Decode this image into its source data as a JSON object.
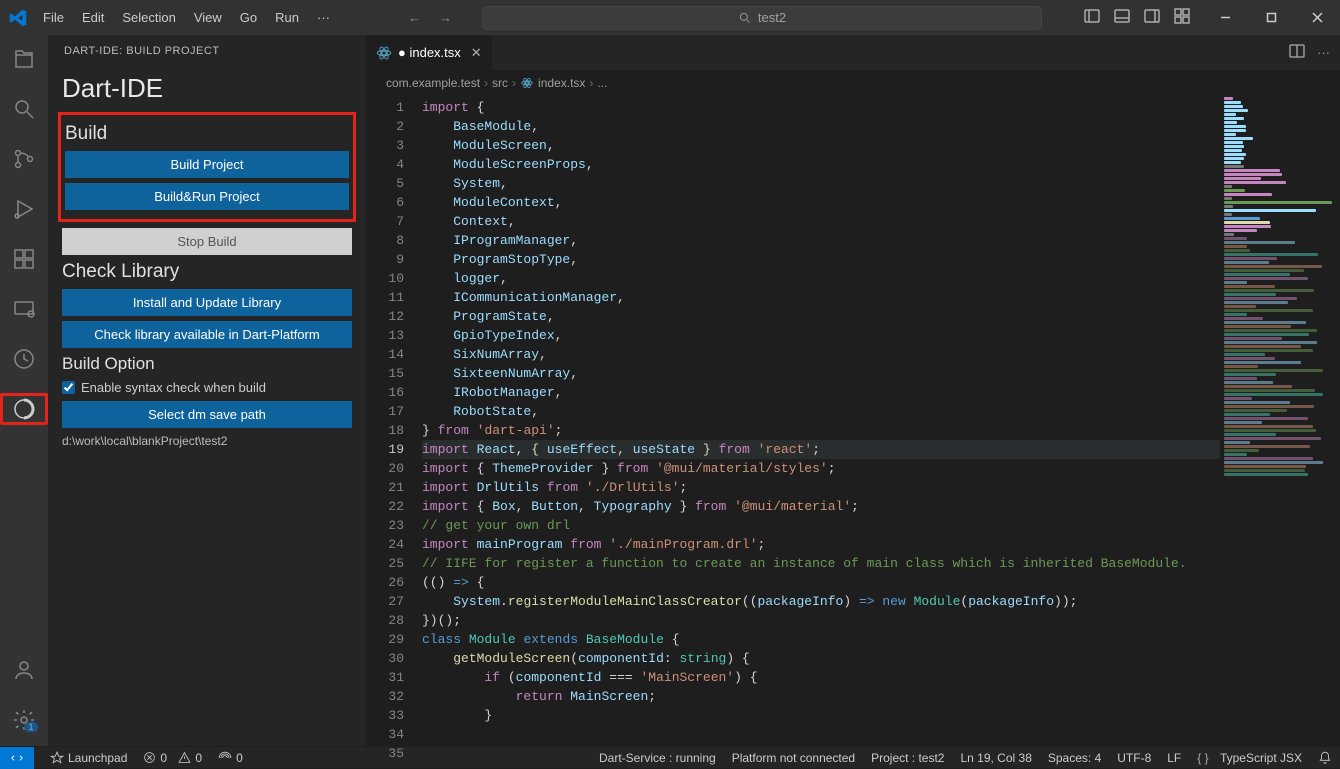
{
  "titlebar": {
    "menus": [
      "File",
      "Edit",
      "Selection",
      "View",
      "Go",
      "Run",
      "···"
    ],
    "search": "test2"
  },
  "sidebar": {
    "header": "DART-IDE: BUILD PROJECT",
    "title": "Dart-IDE",
    "build": {
      "heading": "Build",
      "build_project": "Build Project",
      "build_run": "Build&Run Project",
      "stop": "Stop Build"
    },
    "check": {
      "heading": "Check Library",
      "install": "Install and Update Library",
      "available": "Check library available in Dart-Platform"
    },
    "option": {
      "heading": "Build Option",
      "syntax_label": "Enable syntax check when build",
      "select_path": "Select dm save path",
      "path": "d:\\work\\local\\blankProject\\test2"
    }
  },
  "editor": {
    "tab": "index.tsx",
    "breadcrumb": [
      "com.example.test",
      "src",
      "index.tsx",
      "..."
    ],
    "lines": [
      {
        "n": 1,
        "seg": [
          [
            "k",
            "import"
          ],
          [
            "w",
            " {"
          ]
        ]
      },
      {
        "n": 2,
        "seg": [
          [
            "w",
            "    "
          ],
          [
            "v",
            "BaseModule"
          ],
          [
            "w",
            ","
          ]
        ]
      },
      {
        "n": 3,
        "seg": [
          [
            "w",
            "    "
          ],
          [
            "v",
            "ModuleScreen"
          ],
          [
            "w",
            ","
          ]
        ]
      },
      {
        "n": 4,
        "seg": [
          [
            "w",
            "    "
          ],
          [
            "v",
            "ModuleScreenProps"
          ],
          [
            "w",
            ","
          ]
        ]
      },
      {
        "n": 5,
        "seg": [
          [
            "w",
            "    "
          ],
          [
            "v",
            "System"
          ],
          [
            "w",
            ","
          ]
        ]
      },
      {
        "n": 6,
        "seg": [
          [
            "w",
            "    "
          ],
          [
            "v",
            "ModuleContext"
          ],
          [
            "w",
            ","
          ]
        ]
      },
      {
        "n": 7,
        "seg": [
          [
            "w",
            "    "
          ],
          [
            "v",
            "Context"
          ],
          [
            "w",
            ","
          ]
        ]
      },
      {
        "n": 8,
        "seg": [
          [
            "w",
            "    "
          ],
          [
            "v",
            "IProgramManager"
          ],
          [
            "w",
            ","
          ]
        ]
      },
      {
        "n": 9,
        "seg": [
          [
            "w",
            "    "
          ],
          [
            "v",
            "ProgramStopType"
          ],
          [
            "w",
            ","
          ]
        ]
      },
      {
        "n": 10,
        "seg": [
          [
            "w",
            "    "
          ],
          [
            "v",
            "logger"
          ],
          [
            "w",
            ","
          ]
        ]
      },
      {
        "n": 11,
        "seg": [
          [
            "w",
            "    "
          ],
          [
            "v",
            "ICommunicationManager"
          ],
          [
            "w",
            ","
          ]
        ]
      },
      {
        "n": 12,
        "seg": [
          [
            "w",
            "    "
          ],
          [
            "v",
            "ProgramState"
          ],
          [
            "w",
            ","
          ]
        ]
      },
      {
        "n": 13,
        "seg": [
          [
            "w",
            "    "
          ],
          [
            "v",
            "GpioTypeIndex"
          ],
          [
            "w",
            ","
          ]
        ]
      },
      {
        "n": 14,
        "seg": [
          [
            "w",
            "    "
          ],
          [
            "v",
            "SixNumArray"
          ],
          [
            "w",
            ","
          ]
        ]
      },
      {
        "n": 15,
        "seg": [
          [
            "w",
            "    "
          ],
          [
            "v",
            "SixteenNumArray"
          ],
          [
            "w",
            ","
          ]
        ]
      },
      {
        "n": 16,
        "seg": [
          [
            "w",
            "    "
          ],
          [
            "v",
            "IRobotManager"
          ],
          [
            "w",
            ","
          ]
        ]
      },
      {
        "n": 17,
        "seg": [
          [
            "w",
            "    "
          ],
          [
            "v",
            "RobotState"
          ],
          [
            "w",
            ","
          ]
        ]
      },
      {
        "n": 18,
        "seg": [
          [
            "w",
            "} "
          ],
          [
            "k",
            "from"
          ],
          [
            "w",
            " "
          ],
          [
            "s",
            "'dart-api'"
          ],
          [
            "w",
            ";"
          ]
        ]
      },
      {
        "n": 19,
        "hl": true,
        "seg": [
          [
            "k",
            "import"
          ],
          [
            "w",
            " "
          ],
          [
            "v",
            "React"
          ],
          [
            "w",
            ", "
          ],
          [
            "y",
            "{"
          ],
          [
            "w",
            " "
          ],
          [
            "v",
            "useEffect"
          ],
          [
            "w",
            ", "
          ],
          [
            "v",
            "useState"
          ],
          [
            "w",
            " "
          ],
          [
            "y",
            "}"
          ],
          [
            "w",
            " "
          ],
          [
            "k",
            "from"
          ],
          [
            "w",
            " "
          ],
          [
            "s",
            "'react'"
          ],
          [
            "w",
            ";"
          ]
        ]
      },
      {
        "n": 20,
        "seg": [
          [
            "k",
            "import"
          ],
          [
            "w",
            " { "
          ],
          [
            "v",
            "ThemeProvider"
          ],
          [
            "w",
            " } "
          ],
          [
            "k",
            "from"
          ],
          [
            "w",
            " "
          ],
          [
            "s",
            "'@mui/material/styles'"
          ],
          [
            "w",
            ";"
          ]
        ]
      },
      {
        "n": 21,
        "seg": [
          [
            "k",
            "import"
          ],
          [
            "w",
            " "
          ],
          [
            "v",
            "DrlUtils"
          ],
          [
            "w",
            " "
          ],
          [
            "k",
            "from"
          ],
          [
            "w",
            " "
          ],
          [
            "s",
            "'./DrlUtils'"
          ],
          [
            "w",
            ";"
          ]
        ]
      },
      {
        "n": 22,
        "seg": [
          [
            "k",
            "import"
          ],
          [
            "w",
            " { "
          ],
          [
            "v",
            "Box"
          ],
          [
            "w",
            ", "
          ],
          [
            "v",
            "Button"
          ],
          [
            "w",
            ", "
          ],
          [
            "v",
            "Typography"
          ],
          [
            "w",
            " } "
          ],
          [
            "k",
            "from"
          ],
          [
            "w",
            " "
          ],
          [
            "s",
            "'@mui/material'"
          ],
          [
            "w",
            ";"
          ]
        ]
      },
      {
        "n": 23,
        "seg": [
          [
            "w",
            ""
          ]
        ]
      },
      {
        "n": 24,
        "seg": [
          [
            "c",
            "// get your own drl"
          ]
        ]
      },
      {
        "n": 25,
        "seg": [
          [
            "k",
            "import"
          ],
          [
            "w",
            " "
          ],
          [
            "v",
            "mainProgram"
          ],
          [
            "w",
            " "
          ],
          [
            "k",
            "from"
          ],
          [
            "w",
            " "
          ],
          [
            "s",
            "'./mainProgram.drl'"
          ],
          [
            "w",
            ";"
          ]
        ]
      },
      {
        "n": 26,
        "seg": [
          [
            "w",
            ""
          ]
        ]
      },
      {
        "n": 27,
        "seg": [
          [
            "c",
            "// IIFE for register a function to create an instance of main class which is inherited BaseModule."
          ]
        ]
      },
      {
        "n": 28,
        "seg": [
          [
            "w",
            "(() "
          ],
          [
            "b",
            "=>"
          ],
          [
            "w",
            " {"
          ]
        ]
      },
      {
        "n": 29,
        "seg": [
          [
            "w",
            "    "
          ],
          [
            "v",
            "System"
          ],
          [
            "w",
            "."
          ],
          [
            "y",
            "registerModuleMainClassCreator"
          ],
          [
            "w",
            "(("
          ],
          [
            "v",
            "packageInfo"
          ],
          [
            "w",
            ") "
          ],
          [
            "b",
            "=>"
          ],
          [
            "w",
            " "
          ],
          [
            "b",
            "new"
          ],
          [
            "w",
            " "
          ],
          [
            "t",
            "Module"
          ],
          [
            "w",
            "("
          ],
          [
            "v",
            "packageInfo"
          ],
          [
            "w",
            "));"
          ]
        ]
      },
      {
        "n": 30,
        "seg": [
          [
            "w",
            "})();"
          ]
        ]
      },
      {
        "n": 31,
        "seg": [
          [
            "b",
            "class"
          ],
          [
            "w",
            " "
          ],
          [
            "t",
            "Module"
          ],
          [
            "w",
            " "
          ],
          [
            "b",
            "extends"
          ],
          [
            "w",
            " "
          ],
          [
            "t",
            "BaseModule"
          ],
          [
            "w",
            " {"
          ]
        ]
      },
      {
        "n": 32,
        "seg": [
          [
            "w",
            "    "
          ],
          [
            "y",
            "getModuleScreen"
          ],
          [
            "w",
            "("
          ],
          [
            "v",
            "componentId"
          ],
          [
            "w",
            ": "
          ],
          [
            "t",
            "string"
          ],
          [
            "w",
            ") {"
          ]
        ]
      },
      {
        "n": 33,
        "seg": [
          [
            "w",
            "        "
          ],
          [
            "k",
            "if"
          ],
          [
            "w",
            " ("
          ],
          [
            "v",
            "componentId"
          ],
          [
            "w",
            " === "
          ],
          [
            "s",
            "'MainScreen'"
          ],
          [
            "w",
            ") {"
          ]
        ]
      },
      {
        "n": 34,
        "seg": [
          [
            "w",
            "            "
          ],
          [
            "k",
            "return"
          ],
          [
            "w",
            " "
          ],
          [
            "v",
            "MainScreen"
          ],
          [
            "w",
            ";"
          ]
        ]
      },
      {
        "n": 35,
        "seg": [
          [
            "w",
            "        }"
          ]
        ]
      }
    ]
  },
  "status": {
    "launchpad": "Launchpad",
    "errors": "0",
    "warnings": "0",
    "ports": "0",
    "dart_service": "Dart-Service : running",
    "platform": "Platform not connected",
    "project": "Project : test2",
    "ln": "Ln 19, Col 38",
    "spaces": "Spaces: 4",
    "encoding": "UTF-8",
    "eol": "LF",
    "lang": "TypeScript JSX"
  }
}
